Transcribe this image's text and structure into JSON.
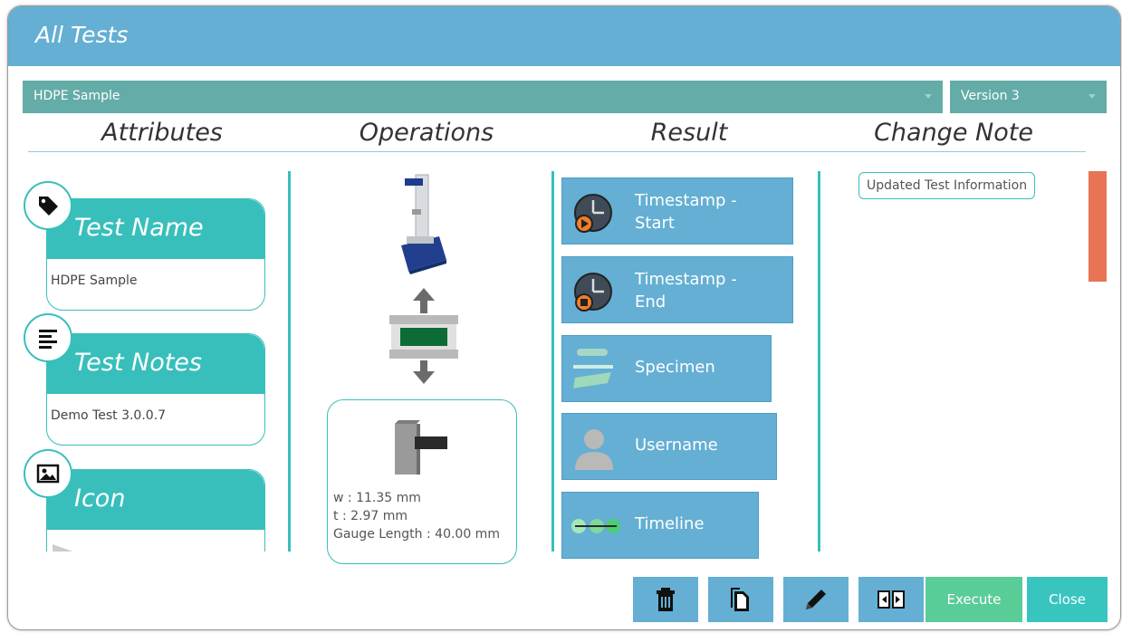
{
  "window": {
    "title": "All Tests"
  },
  "selectors": {
    "sample": "HDPE Sample",
    "version": "Version 3"
  },
  "columns": {
    "attributes": "Attributes",
    "operations": "Operations",
    "result": "Result",
    "change_note": "Change Note"
  },
  "attributes": [
    {
      "label": "Test Name",
      "value": "HDPE Sample",
      "icon": "tag-icon"
    },
    {
      "label": "Test Notes",
      "value": "Demo Test 3.0.0.7",
      "icon": "notes-icon"
    },
    {
      "label": "Icon",
      "value": "",
      "icon": "image-icon"
    }
  ],
  "operations": {
    "specimen": {
      "w": "w : 11.35 mm",
      "t": "t : 2.97 mm",
      "gauge": "Gauge Length : 40.00 mm"
    }
  },
  "results": [
    {
      "line1": "Timestamp -",
      "line2": "Start",
      "icon": "timestamp-start-icon"
    },
    {
      "line1": "Timestamp -",
      "line2": "End",
      "icon": "timestamp-end-icon"
    },
    {
      "line1": "Specimen",
      "line2": "",
      "icon": "specimen-icon"
    },
    {
      "line1": "Username",
      "line2": "",
      "icon": "user-icon"
    },
    {
      "line1": "Timeline",
      "line2": "",
      "icon": "timeline-icon"
    }
  ],
  "change_notes": [
    "Updated Test Information"
  ],
  "footer": {
    "execute": "Execute",
    "close": "Close"
  },
  "colors": {
    "header": "#64afd3",
    "teal": "#38bfbb",
    "execute": "#5acc98",
    "scroll": "#e87355"
  }
}
